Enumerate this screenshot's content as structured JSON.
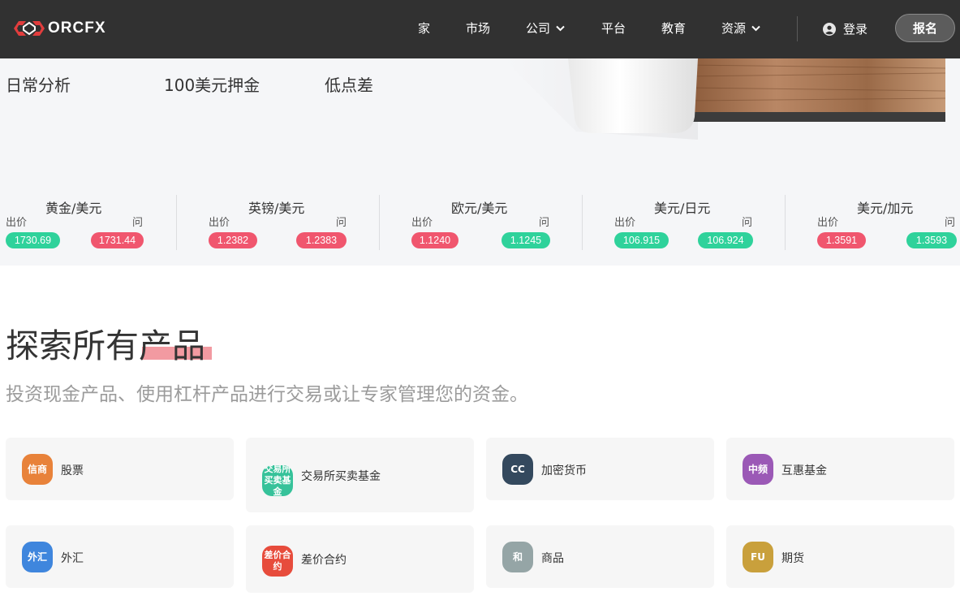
{
  "nav": {
    "logo_text": "ORCFX",
    "items": [
      {
        "label": "家",
        "dropdown": false
      },
      {
        "label": "市场",
        "dropdown": false
      },
      {
        "label": "公司",
        "dropdown": true
      },
      {
        "label": "平台",
        "dropdown": false
      },
      {
        "label": "教育",
        "dropdown": false
      },
      {
        "label": "资源",
        "dropdown": true
      }
    ],
    "login_label": "登录",
    "signup_label": "报名"
  },
  "hero": {
    "features": [
      "日常分析",
      "100美元押金",
      "低点差"
    ]
  },
  "tickers": [
    {
      "pair": "黄金/美元",
      "bid_label": "出价",
      "ask_label": "问",
      "bid": "1730.69",
      "ask": "1731.44",
      "bid_color": "green",
      "ask_color": "red"
    },
    {
      "pair": "英镑/美元",
      "bid_label": "出价",
      "ask_label": "问",
      "bid": "1.2382",
      "ask": "1.2383",
      "bid_color": "red",
      "ask_color": "red"
    },
    {
      "pair": "欧元/美元",
      "bid_label": "出价",
      "ask_label": "问",
      "bid": "1.1240",
      "ask": "1.1245",
      "bid_color": "red",
      "ask_color": "green"
    },
    {
      "pair": "美元/日元",
      "bid_label": "出价",
      "ask_label": "问",
      "bid": "106.915",
      "ask": "106.924",
      "bid_color": "green",
      "ask_color": "green"
    },
    {
      "pair": "美元/加元",
      "bid_label": "出价",
      "ask_label": "问",
      "bid": "1.3591",
      "ask": "1.3593",
      "bid_color": "red",
      "ask_color": "green"
    }
  ],
  "explore": {
    "title": "探索所有产品",
    "subtitle": "投资现金产品、使用杠杆产品进行交易或让专家管理您的资金。"
  },
  "products": [
    {
      "icon_text": "信商",
      "label": "股票",
      "color": "#e8823a"
    },
    {
      "icon_text": "交易所买卖基金",
      "label": "交易所买卖基金",
      "color": "#36c29a"
    },
    {
      "icon_text": "CC",
      "label": "加密货币",
      "color": "#34495e"
    },
    {
      "icon_text": "中频",
      "label": "互惠基金",
      "color": "#9b59b6"
    },
    {
      "icon_text": "外汇",
      "label": "外汇",
      "color": "#3f86dd"
    },
    {
      "icon_text": "差价合约",
      "label": "差价合约",
      "color": "#e74c3c"
    },
    {
      "icon_text": "和",
      "label": "商品",
      "color": "#95a5a6"
    },
    {
      "icon_text": "FU",
      "label": "期货",
      "color": "#c9a03c"
    }
  ]
}
